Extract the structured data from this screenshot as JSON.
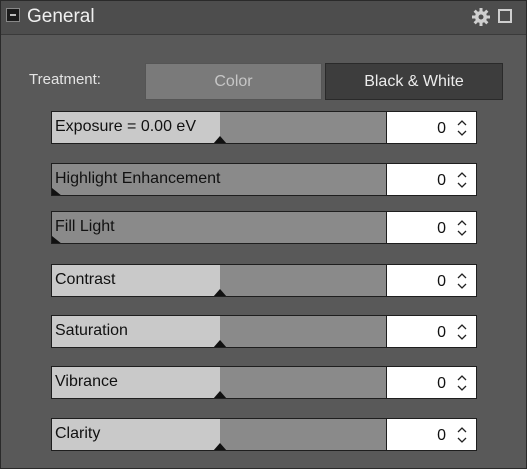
{
  "panel": {
    "title": "General",
    "header_icons": [
      "collapse-icon",
      "gear-icon",
      "window-icon"
    ]
  },
  "treatment": {
    "label": "Treatment:",
    "options": [
      "Color",
      "Black & White"
    ],
    "selected": "Color"
  },
  "sliders": [
    {
      "label": "Exposure = 0.00 eV",
      "value": "0",
      "level": 0.5
    },
    {
      "label": "Highlight Enhancement",
      "value": "0",
      "level": 0.0
    },
    {
      "label": "Fill Light",
      "value": "0",
      "level": 0.0
    },
    {
      "label": "Contrast",
      "value": "0",
      "level": 0.5
    },
    {
      "label": "Saturation",
      "value": "0",
      "level": 0.5
    },
    {
      "label": "Vibrance",
      "value": "0",
      "level": 0.5
    },
    {
      "label": "Clarity",
      "value": "0",
      "level": 0.5
    }
  ],
  "colors": {
    "panel_bg": "#595959",
    "slider_track": "#8a8a8a",
    "slider_fill": "#c9c9c9",
    "segment_selected": "#7a7a7a",
    "segment_unselected": "#3d3d3d"
  }
}
